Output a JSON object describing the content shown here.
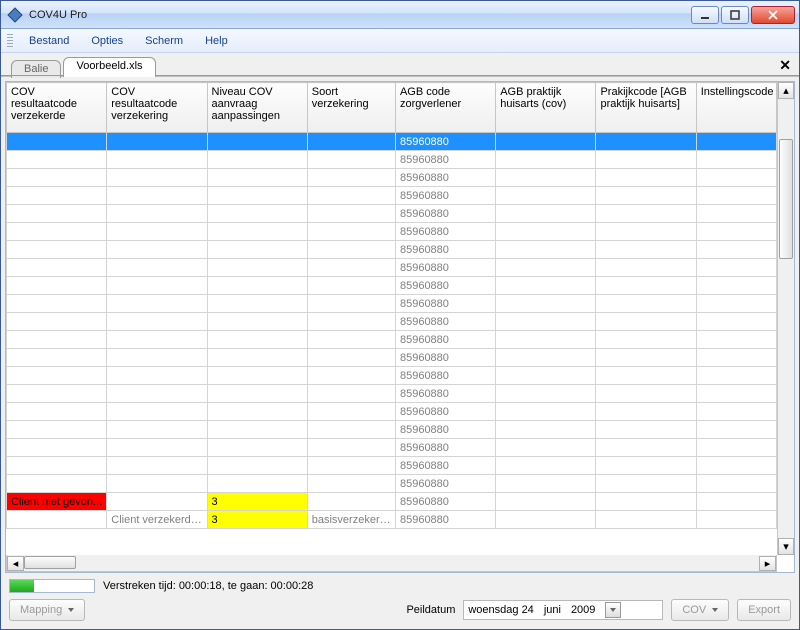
{
  "titlebar": {
    "icon": "app-icon",
    "title": "COV4U Pro"
  },
  "menu": [
    "Bestand",
    "Opties",
    "Scherm",
    "Help"
  ],
  "tabs": [
    {
      "label": "Balie",
      "active": false
    },
    {
      "label": "Voorbeeld.xls",
      "active": true
    }
  ],
  "columns": [
    "COV resultaatcode verzekerde",
    "COV resultaatcode verzekering",
    "Niveau COV aanvraag aanpassingen",
    "Soort verzekering",
    "AGB code zorgverlener",
    "AGB praktijk huisarts (cov)",
    "Prakijkcode [AGB praktijk huisarts]",
    "Instellingscode"
  ],
  "rows": [
    {
      "selected": true,
      "c0": "",
      "c1": "",
      "c2": "",
      "c3": "",
      "c4": "85960880",
      "c5": "",
      "c6": "",
      "c7": ""
    },
    {
      "c0": "",
      "c1": "",
      "c2": "",
      "c3": "",
      "c4": "85960880",
      "c5": "",
      "c6": "",
      "c7": ""
    },
    {
      "c0": "",
      "c1": "",
      "c2": "",
      "c3": "",
      "c4": "85960880",
      "c5": "",
      "c6": "",
      "c7": ""
    },
    {
      "c0": "",
      "c1": "",
      "c2": "",
      "c3": "",
      "c4": "85960880",
      "c5": "",
      "c6": "",
      "c7": ""
    },
    {
      "c0": "",
      "c1": "",
      "c2": "",
      "c3": "",
      "c4": "85960880",
      "c5": "",
      "c6": "",
      "c7": ""
    },
    {
      "c0": "",
      "c1": "",
      "c2": "",
      "c3": "",
      "c4": "85960880",
      "c5": "",
      "c6": "",
      "c7": ""
    },
    {
      "c0": "",
      "c1": "",
      "c2": "",
      "c3": "",
      "c4": "85960880",
      "c5": "",
      "c6": "",
      "c7": ""
    },
    {
      "c0": "",
      "c1": "",
      "c2": "",
      "c3": "",
      "c4": "85960880",
      "c5": "",
      "c6": "",
      "c7": ""
    },
    {
      "c0": "",
      "c1": "",
      "c2": "",
      "c3": "",
      "c4": "85960880",
      "c5": "",
      "c6": "",
      "c7": ""
    },
    {
      "c0": "",
      "c1": "",
      "c2": "",
      "c3": "",
      "c4": "85960880",
      "c5": "",
      "c6": "",
      "c7": ""
    },
    {
      "c0": "",
      "c1": "",
      "c2": "",
      "c3": "",
      "c4": "85960880",
      "c5": "",
      "c6": "",
      "c7": ""
    },
    {
      "c0": "",
      "c1": "",
      "c2": "",
      "c3": "",
      "c4": "85960880",
      "c5": "",
      "c6": "",
      "c7": ""
    },
    {
      "c0": "",
      "c1": "",
      "c2": "",
      "c3": "",
      "c4": "85960880",
      "c5": "",
      "c6": "",
      "c7": ""
    },
    {
      "c0": "",
      "c1": "",
      "c2": "",
      "c3": "",
      "c4": "85960880",
      "c5": "",
      "c6": "",
      "c7": ""
    },
    {
      "c0": "",
      "c1": "",
      "c2": "",
      "c3": "",
      "c4": "85960880",
      "c5": "",
      "c6": "",
      "c7": ""
    },
    {
      "c0": "",
      "c1": "",
      "c2": "",
      "c3": "",
      "c4": "85960880",
      "c5": "",
      "c6": "",
      "c7": ""
    },
    {
      "c0": "",
      "c1": "",
      "c2": "",
      "c3": "",
      "c4": "85960880",
      "c5": "",
      "c6": "",
      "c7": ""
    },
    {
      "c0": "",
      "c1": "",
      "c2": "",
      "c3": "",
      "c4": "85960880",
      "c5": "",
      "c6": "",
      "c7": ""
    },
    {
      "c0": "",
      "c1": "",
      "c2": "",
      "c3": "",
      "c4": "85960880",
      "c5": "",
      "c6": "",
      "c7": ""
    },
    {
      "c0": "",
      "c1": "",
      "c2": "",
      "c3": "",
      "c4": "85960880",
      "c5": "",
      "c6": "",
      "c7": ""
    },
    {
      "c0": "Client niet gevon...",
      "c0_class": "cell-red",
      "c1": "",
      "c2": "3",
      "c2_class": "cell-yellow",
      "c3": "",
      "c4": "85960880",
      "c5": "",
      "c6": "",
      "c7": ""
    },
    {
      "c0": "",
      "c1": "Client verzekerd. ...",
      "c2": "3",
      "c2_class": "cell-yellow",
      "c3": "basisverzekering ...",
      "c4": "85960880",
      "c5": "",
      "c6": "",
      "c7": ""
    }
  ],
  "status": {
    "elapsed_label": "Verstreken tijd: 00:00:18, te gaan: 00:00:28",
    "progress_percent": 28
  },
  "bottom": {
    "mapping_label": "Mapping",
    "peildatum_label": "Peildatum",
    "date_day": "woensdag 24",
    "date_month": "juni",
    "date_year": "2009",
    "cov_label": "COV",
    "export_label": "Export"
  }
}
